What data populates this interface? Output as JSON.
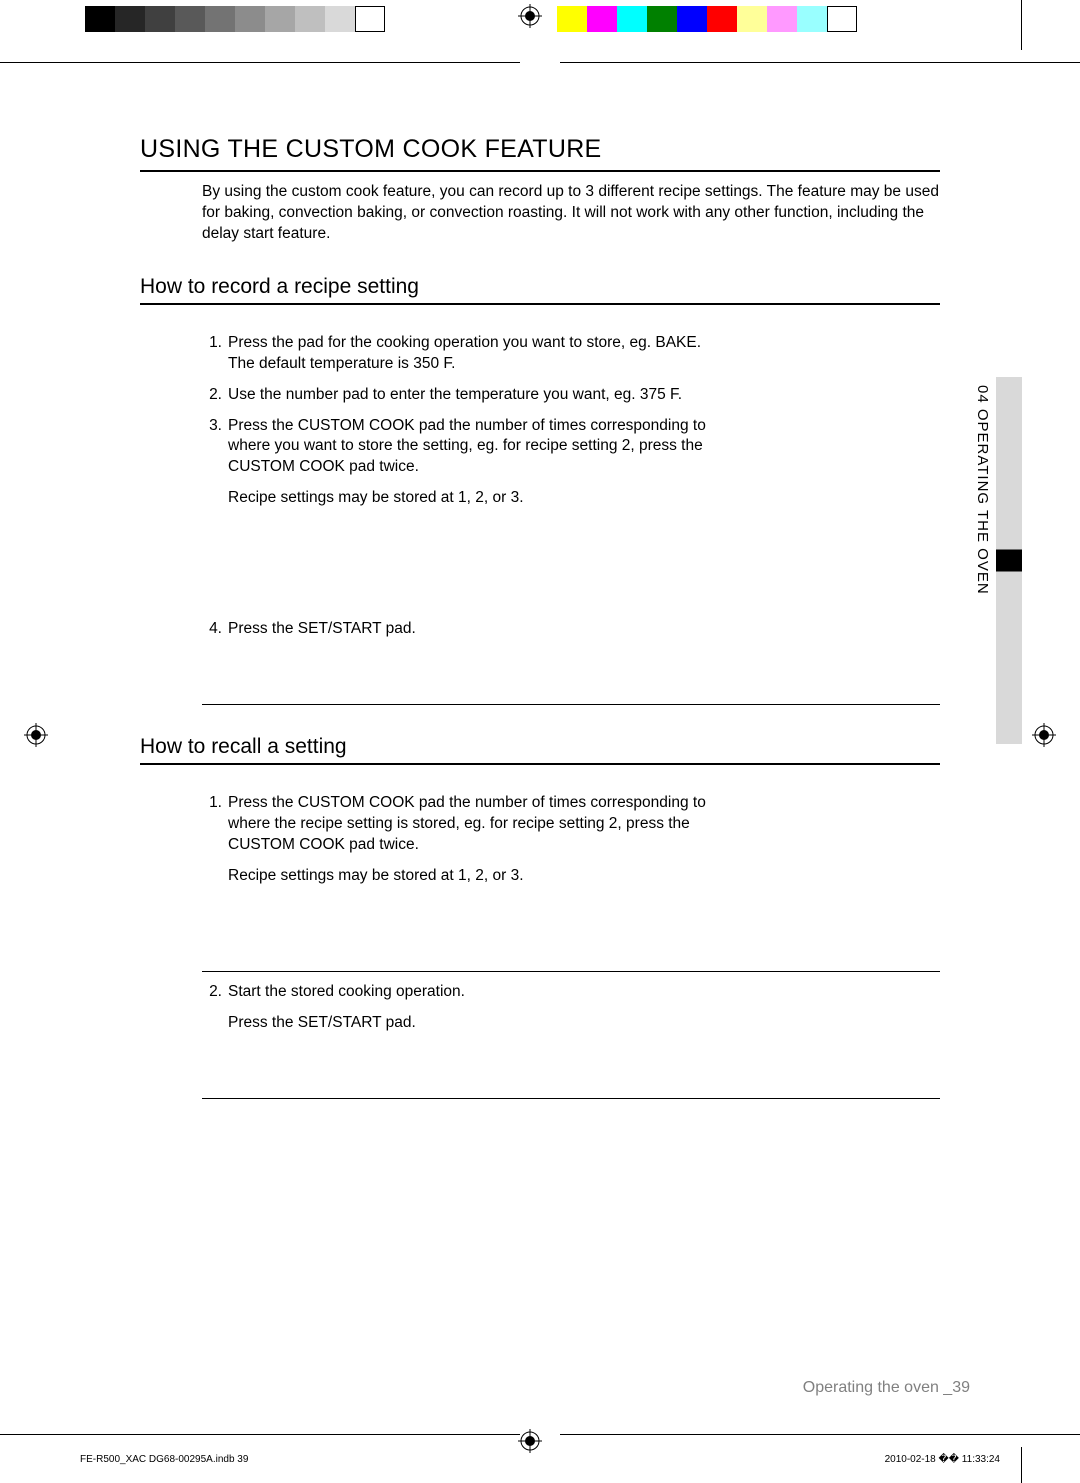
{
  "mainHeading": "USING THE CUSTOM COOK FEATURE",
  "intro": "By using the custom cook feature, you can record up to 3 different recipe settings. The feature may be used for baking, convection baking, or convection roasting. It will not work with any other function, including the delay start feature.",
  "section1": {
    "heading": "How to record a recipe setting",
    "steps": [
      {
        "num": "1.",
        "text": "Press the pad for the cooking operation you want to store, eg. BAKE. The default temperature is 350 F."
      },
      {
        "num": "2.",
        "text": "Use the number pad to enter the temperature you want, eg. 375 F."
      },
      {
        "num": "3.",
        "text": "Press the CUSTOM COOK pad the number of times corresponding to where you want to store the setting, eg. for recipe setting 2, press the CUSTOM COOK pad twice."
      }
    ],
    "note1": "Recipe settings may be stored at 1, 2, or 3.",
    "steps2": [
      {
        "num": "4.",
        "text": "Press the SET/START pad."
      }
    ]
  },
  "section2": {
    "heading": "How to recall a setting",
    "steps": [
      {
        "num": "1.",
        "text": "Press the CUSTOM COOK pad the number of times corresponding to where the recipe setting is stored, eg. for recipe setting 2, press the CUSTOM COOK pad twice."
      }
    ],
    "note1": "Recipe settings may be stored at 1, 2, or 3.",
    "steps2": [
      {
        "num": "2.",
        "text": "Start the stored cooking operation."
      }
    ],
    "note2": "Press the SET/START pad."
  },
  "sideTab": "04  OPERATING THE OVEN",
  "footer": "Operating the oven _39",
  "printFooterLeft": "FE-R500_XAC DG68-00295A.indb   39",
  "printFooterRight": "2010-02-18   �� 11:33:24",
  "colorsLeft": [
    "#000000",
    "#262626",
    "#404040",
    "#595959",
    "#737373",
    "#8c8c8c",
    "#a6a6a6",
    "#bfbfbf",
    "#d9d9d9",
    "#ffffff"
  ],
  "colorsRight": [
    "#ffff00",
    "#ff00ff",
    "#00ffff",
    "#008000",
    "#0000ff",
    "#ff0000",
    "#ffff80",
    "#ff80ff",
    "#80ffff",
    "#ffffff"
  ]
}
